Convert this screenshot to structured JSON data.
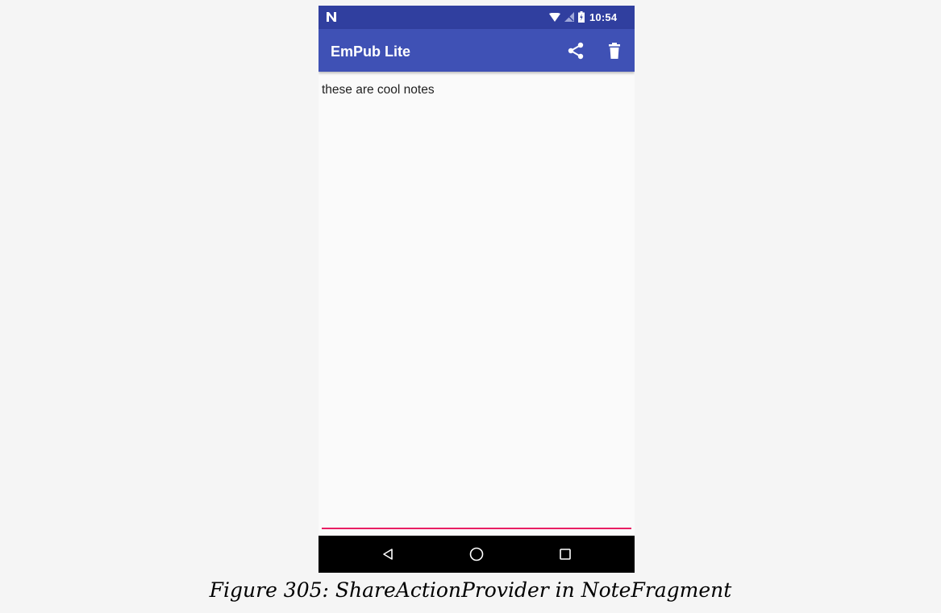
{
  "status_bar": {
    "time": "10:54",
    "icons": [
      "notification-n-icon",
      "wifi-icon",
      "no-signal-icon",
      "battery-charging-icon"
    ]
  },
  "app_bar": {
    "title": "EmPub Lite",
    "actions": [
      "share-icon",
      "delete-icon"
    ],
    "colors": {
      "primary": "#3f51b5",
      "primary_dark": "#303f9f"
    }
  },
  "note": {
    "text": "these are cool notes",
    "accent_color": "#e91e63"
  },
  "nav_bar": {
    "buttons": [
      "back-icon",
      "home-icon",
      "recents-icon"
    ]
  },
  "caption": "Figure 305: ShareActionProvider in NoteFragment"
}
